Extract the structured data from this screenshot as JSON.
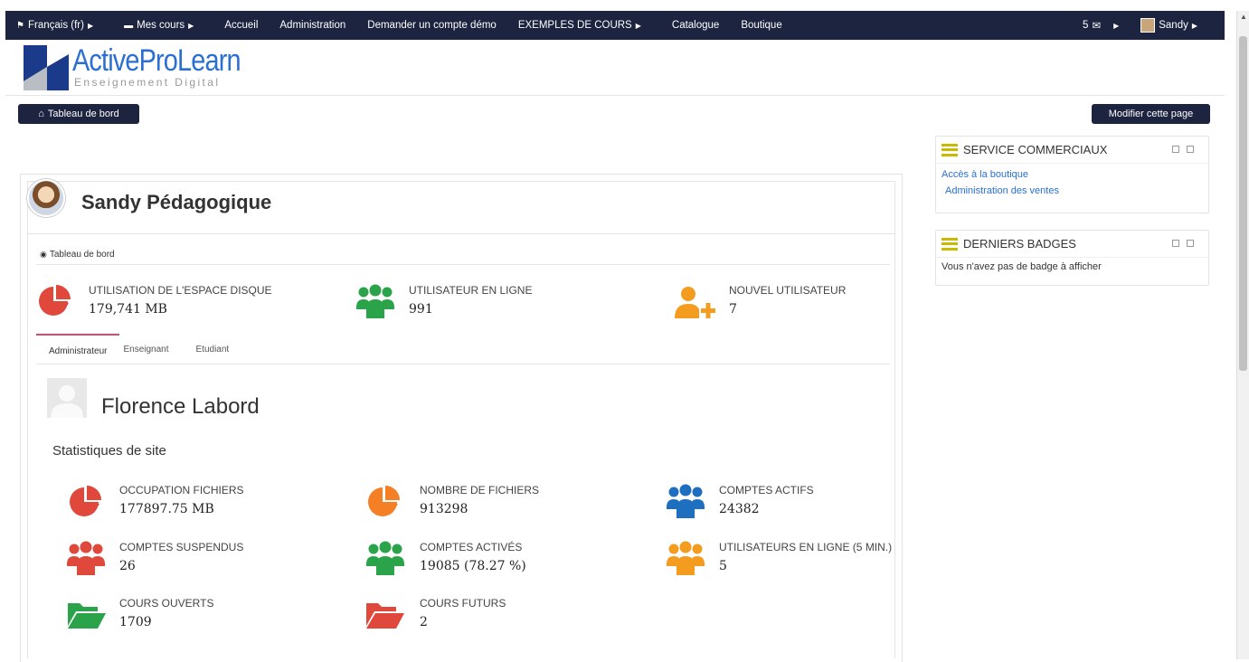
{
  "topnav": {
    "items": [
      {
        "label": "Français (fr)",
        "caret": true
      },
      {
        "label": "Mes cours",
        "caret": true
      },
      {
        "label": "Accueil",
        "caret": false
      },
      {
        "label": "Administration",
        "caret": false
      },
      {
        "label": "Demander un compte démo",
        "caret": false
      },
      {
        "label": "EXEMPLES DE COURS",
        "caret": true
      },
      {
        "label": "Catalogue",
        "caret": false
      },
      {
        "label": "Boutique",
        "caret": false
      }
    ],
    "messages_count": "5",
    "user": "Sandy"
  },
  "logo": {
    "title": "ActiveProLearn",
    "subtitle": "Enseignement Digital"
  },
  "buttons": {
    "dashboard": "Tableau de bord",
    "edit_page": "Modifier cette page"
  },
  "profile": {
    "name": "Sandy Pédagogique"
  },
  "breadcrumb": "Tableau de bord",
  "top_stats": [
    {
      "label": "UTILISATION DE L'ESPACE DISQUE",
      "value": "179,741 MB",
      "icon": "pie-chart-icon",
      "color": "#e0483c"
    },
    {
      "label": "UTILISATEUR EN LIGNE",
      "value": "991",
      "icon": "users-icon",
      "color": "#2aa34a"
    },
    {
      "label": "NOUVEL UTILISATEUR",
      "value": "7",
      "icon": "user-plus-icon",
      "color": "#f39c1f"
    }
  ],
  "tabs": [
    "Administrateur",
    "Enseignant",
    "Etudiant"
  ],
  "user_card": {
    "name": "Florence Labord"
  },
  "site_stats_title": "Statistiques de site",
  "site_stats": [
    {
      "label": "OCCUPATION FICHIERS",
      "value": "177897.75 MB",
      "icon": "pie-chart-icon",
      "color": "#e0483c"
    },
    {
      "label": "NOMBRE DE FICHIERS",
      "value": "913298",
      "icon": "pie-chart-icon",
      "color": "#f57f25"
    },
    {
      "label": "COMPTES ACTIFS",
      "value": "24382",
      "icon": "users-icon",
      "color": "#1f6fc0"
    },
    {
      "label": "COMPTES SUSPENDUS",
      "value": "26",
      "icon": "users-icon",
      "color": "#e0483c"
    },
    {
      "label": "COMPTES ACTIVÉS",
      "value": "19085 (78.27 %)",
      "icon": "users-icon",
      "color": "#2aa34a"
    },
    {
      "label": "UTILISATEURS EN LIGNE (5 MIN.)",
      "value": "5",
      "icon": "users-icon",
      "color": "#f39c1f"
    },
    {
      "label": "COURS OUVERTS",
      "value": "1709",
      "icon": "folder-open-icon",
      "color": "#2aa34a"
    },
    {
      "label": "COURS FUTURS",
      "value": "2",
      "icon": "folder-open-icon",
      "color": "#e0483c"
    }
  ],
  "sidebar": {
    "service": {
      "title": "SERVICE COMMERCIAUX",
      "links": [
        "Accès à la boutique",
        "Administration des ventes"
      ]
    },
    "badges": {
      "title": "DERNIERS BADGES",
      "text": "Vous n'avez pas de badge à afficher"
    }
  }
}
